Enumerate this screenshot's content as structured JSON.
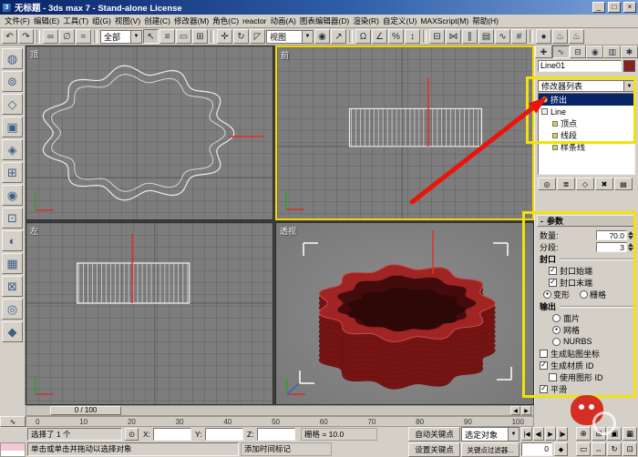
{
  "window": {
    "title": "无标题 - 3ds max 7 - Stand-alone License",
    "minimize": "_",
    "maximize": "□",
    "close": "×"
  },
  "menu": {
    "items": [
      "文件(F)",
      "编辑(E)",
      "工具(T)",
      "组(G)",
      "视图(V)",
      "创建(C)",
      "修改器(M)",
      "角色(C)",
      "reactor",
      "动画(A)",
      "图表编辑器(D)",
      "渲染(R)",
      "自定义(U)",
      "MAXScript(M)",
      "帮助(H)"
    ]
  },
  "toolbar": {
    "selection_filter": "全部",
    "ref_coord": "视图",
    "icons": [
      {
        "name": "undo-icon",
        "glyph": "↶"
      },
      {
        "name": "redo-icon",
        "glyph": "↷"
      },
      {
        "name": "select-link-icon",
        "glyph": "∞"
      },
      {
        "name": "unlink-icon",
        "glyph": "∅"
      },
      {
        "name": "bind-spacewarp-icon",
        "glyph": "≈"
      },
      {
        "name": "select-object-icon",
        "glyph": "↖"
      },
      {
        "name": "select-by-name-icon",
        "glyph": "≡"
      },
      {
        "name": "selection-region-icon",
        "glyph": "▭"
      },
      {
        "name": "window-crossing-icon",
        "glyph": "⊞"
      },
      {
        "name": "select-move-icon",
        "glyph": "✛"
      },
      {
        "name": "select-rotate-icon",
        "glyph": "↻"
      },
      {
        "name": "select-scale-icon",
        "glyph": "◸"
      },
      {
        "name": "use-pivot-icon",
        "glyph": "◉"
      },
      {
        "name": "select-manipulate-icon",
        "glyph": "↗"
      },
      {
        "name": "snap-toggle-icon",
        "glyph": "Ω"
      },
      {
        "name": "angle-snap-icon",
        "glyph": "∠"
      },
      {
        "name": "percent-snap-icon",
        "glyph": "%"
      },
      {
        "name": "spinner-snap-icon",
        "glyph": "↕"
      },
      {
        "name": "named-selection-icon",
        "glyph": "⊟"
      },
      {
        "name": "mirror-icon",
        "glyph": "⋈"
      },
      {
        "name": "align-icon",
        "glyph": "∥"
      },
      {
        "name": "layer-manager-icon",
        "glyph": "▤"
      },
      {
        "name": "curve-editor-icon",
        "glyph": "∿"
      },
      {
        "name": "schematic-view-icon",
        "glyph": "#"
      },
      {
        "name": "material-editor-icon",
        "glyph": "●"
      },
      {
        "name": "render-setup-icon",
        "glyph": "♨"
      },
      {
        "name": "quick-render-icon",
        "glyph": "♨"
      }
    ]
  },
  "left_toolbar": {
    "glyphs": [
      "◍",
      "⊚",
      "◇",
      "▣",
      "◈",
      "⊞",
      "◉",
      "⊡",
      "◐",
      "▦",
      "⊠",
      "◎",
      "◆"
    ]
  },
  "viewports": {
    "top_label": "顶",
    "front_label": "前",
    "left_label": "左",
    "persp_label": "透视"
  },
  "command_panel": {
    "tabs": [
      {
        "name": "create",
        "glyph": "✚"
      },
      {
        "name": "modify",
        "glyph": "∿"
      },
      {
        "name": "hierarchy",
        "glyph": "⊟"
      },
      {
        "name": "motion",
        "glyph": "◉"
      },
      {
        "name": "display",
        "glyph": "▥"
      },
      {
        "name": "utilities",
        "glyph": "✱"
      }
    ],
    "object_name": "Line01",
    "modifier_list_label": "修改器列表",
    "stack_items": [
      {
        "label": "挤出"
      },
      {
        "label": "Line"
      },
      {
        "label": "顶点"
      },
      {
        "label": "线段"
      },
      {
        "label": "样条线"
      }
    ],
    "stack_buttons": [
      {
        "name": "pin-stack-icon",
        "glyph": "◎"
      },
      {
        "name": "show-end-result-icon",
        "glyph": "≣"
      },
      {
        "name": "make-unique-icon",
        "glyph": "◇"
      },
      {
        "name": "remove-modifier-icon",
        "glyph": "✖"
      },
      {
        "name": "configure-modifier-sets-icon",
        "glyph": "▤"
      }
    ],
    "parameters": {
      "header": "参数",
      "amount_label": "数量:",
      "amount_value": "70.0",
      "segments_label": "分段:",
      "segments_value": "3",
      "cap_group_label": "封口",
      "cap_start_label": "封口始端",
      "cap_start_check": "✓",
      "cap_end_label": "封口末端",
      "cap_end_check": "✓",
      "morph_label": "变形",
      "morph_dot": "●",
      "grid_label": "栅格",
      "grid_dot": "",
      "output_group_label": "输出",
      "patch_label": "面片",
      "patch_dot": "",
      "mesh_label": "网格",
      "mesh_dot": "●",
      "nurbs_label": "NURBS",
      "nurbs_dot": "",
      "gen_mapping_label": "生成贴图坐标",
      "gen_mapping_check": "",
      "gen_material_label": "生成材质 ID",
      "gen_material_check": "✓",
      "use_shape_label": "使用图形 ID",
      "use_shape_check": "",
      "smooth_label": "平滑",
      "smooth_check": "✓"
    }
  },
  "timeline": {
    "slider_label": "0 / 100",
    "ticks": [
      "0",
      "10",
      "20",
      "30",
      "40",
      "50",
      "60",
      "70",
      "80",
      "90",
      "100"
    ],
    "prev_glyph": "◀",
    "next_glyph": "▶",
    "mini_curve_glyph": "∿"
  },
  "time": {
    "buttons": [
      "|◀",
      "◀|",
      "▶",
      "|▶",
      "▶|"
    ],
    "key_glyph": "◆"
  },
  "nav": {
    "icons": [
      "⊕",
      "⊞",
      "▣",
      "▦",
      "▭",
      "⇔",
      "↻",
      "⊡"
    ]
  },
  "status": {
    "selection": "选择了 1 个",
    "lock_glyph": "⊙",
    "x": "X:",
    "y": "Y:",
    "z": "Z:",
    "grid": "栅格 = 10.0",
    "prompt": "单击或单击并拖动以选择对象",
    "add_time_tag": "添加时间标记",
    "auto_key": "自动关键点",
    "set_key": "设置关键点",
    "selected_filter": "选定对象",
    "key_filters": "关键点过滤器...",
    "frame_value": "0"
  },
  "colors": {
    "annotation_yellow": "#f0e20a",
    "arrow_red": "#e8150e",
    "object_red": "#8e1f1f",
    "active_viewport_border": "#f5d800"
  }
}
